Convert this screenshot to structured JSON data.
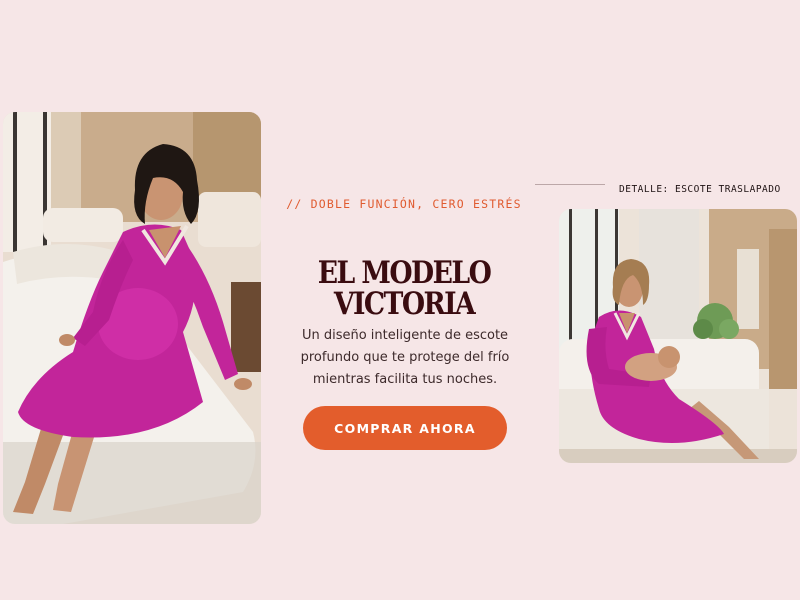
{
  "hero": {
    "eyebrow": "// DOBLE FUNCIÓN, CERO ESTRÉS",
    "title_line1": "EL MODELO",
    "title_line2": "VICTORIA",
    "description": "Un diseño inteligente de escote profundo que te protege del frío mientras facilita tus noches.",
    "cta_label": "COMPRAR AHORA"
  },
  "detail": {
    "label": "DETALLE: ESCOTE TRASLAPADO"
  },
  "colors": {
    "background": "#f6e6e7",
    "accent": "#e35d2c",
    "title": "#3a0c10",
    "dress": "#c2259a"
  }
}
